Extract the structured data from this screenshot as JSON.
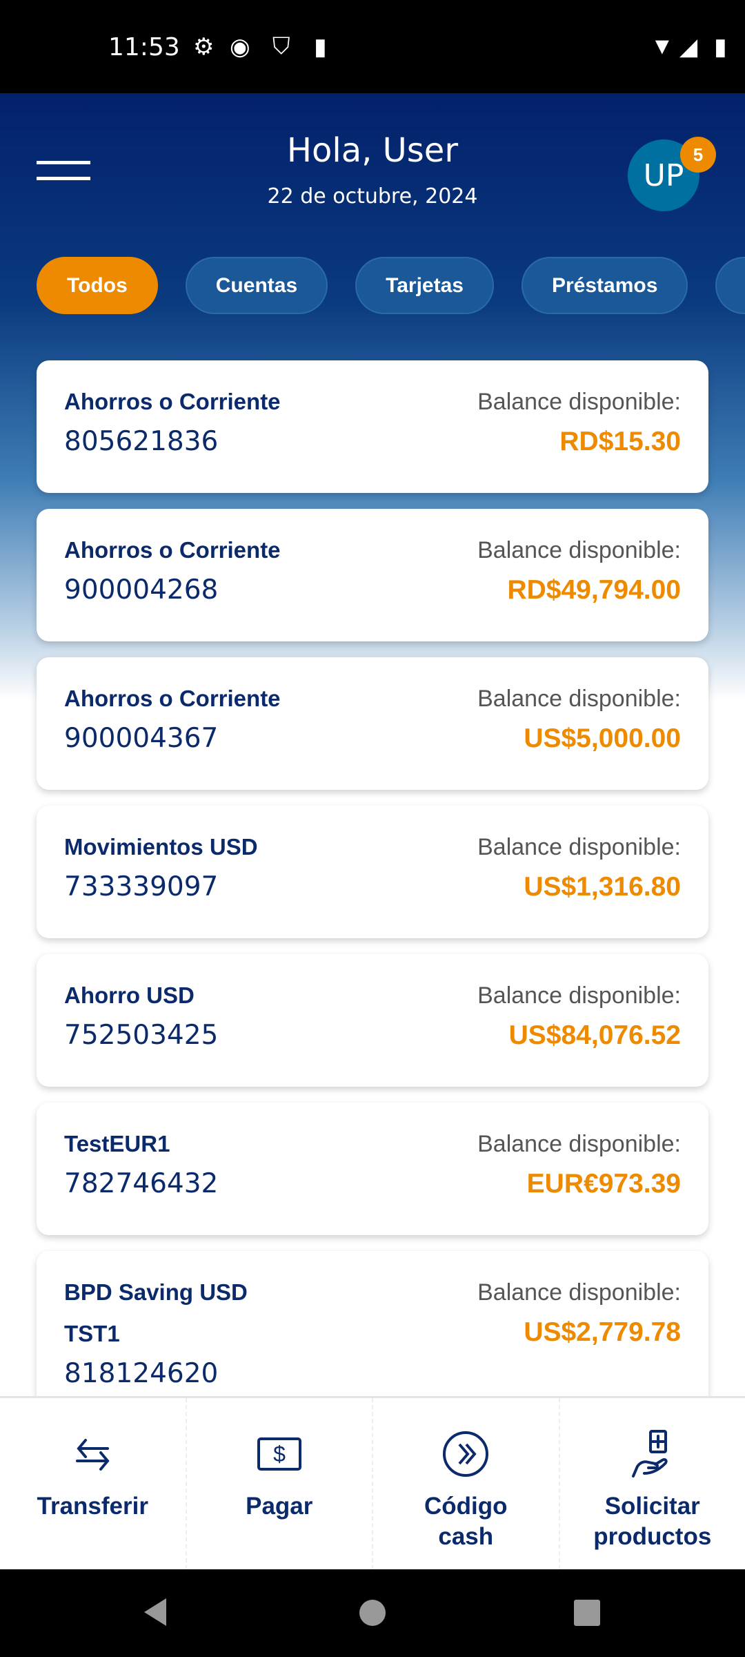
{
  "status": {
    "time": "11:53"
  },
  "header": {
    "greeting": "Hola, User",
    "date": "22 de octubre, 2024",
    "avatar_initials": "UP",
    "notification_count": "5"
  },
  "filters": [
    {
      "label": "Todos",
      "active": true
    },
    {
      "label": "Cuentas"
    },
    {
      "label": "Tarjetas"
    },
    {
      "label": "Préstamos"
    },
    {
      "label": ""
    }
  ],
  "accounts": [
    {
      "name": "Ahorros o Corriente",
      "number": "805621836",
      "balance_label": "Balance disponible:",
      "balance": "RD$15.30"
    },
    {
      "name": "Ahorros o Corriente",
      "number": "900004268",
      "balance_label": "Balance disponible:",
      "balance": "RD$49,794.00"
    },
    {
      "name": "Ahorros o Corriente",
      "number": "900004367",
      "balance_label": "Balance disponible:",
      "balance": "US$5,000.00"
    },
    {
      "name": "Movimientos USD",
      "number": "733339097",
      "balance_label": "Balance disponible:",
      "balance": "US$1,316.80"
    },
    {
      "name": "Ahorro USD",
      "number": "752503425",
      "balance_label": "Balance disponible:",
      "balance": "US$84,076.52"
    },
    {
      "name": "TestEUR1",
      "number": "782746432",
      "balance_label": "Balance disponible:",
      "balance": "EUR€973.39"
    },
    {
      "name": "BPD Saving USD TST1",
      "number": "818124620",
      "balance_label": "Balance disponible:",
      "balance": "US$2,779.78"
    }
  ],
  "bottom_nav": [
    {
      "label": "Transferir"
    },
    {
      "label": "Pagar"
    },
    {
      "label": "Código cash"
    },
    {
      "label": "Solicitar productos"
    }
  ],
  "colors": {
    "navy": "#03216b",
    "accent": "#ee8a00",
    "chip": "#1b5898",
    "avatar": "#0070a0"
  }
}
